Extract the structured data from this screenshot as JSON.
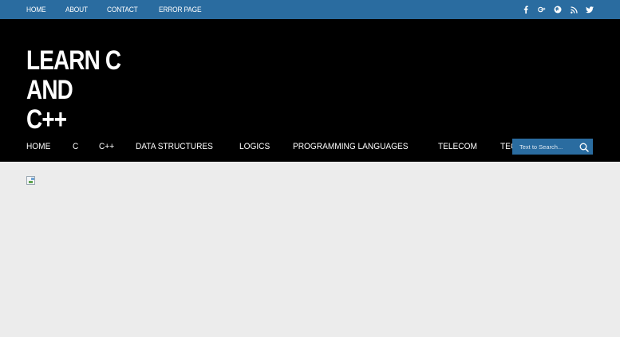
{
  "top_nav": [
    {
      "label": "HOME"
    },
    {
      "label": "ABOUT"
    },
    {
      "label": "CONTACT"
    },
    {
      "label": "ERROR PAGE"
    }
  ],
  "social_icons": [
    "facebook-icon",
    "google-plus-icon",
    "pinterest-icon",
    "rss-icon",
    "twitter-icon"
  ],
  "site": {
    "title_line1": "LEARN C AND",
    "title_line2": "C++"
  },
  "main_nav": [
    {
      "label": "HOME"
    },
    {
      "label": "C"
    },
    {
      "label": "C++"
    },
    {
      "label": "DATA STRUCTURES"
    },
    {
      "label": "LOGICS"
    },
    {
      "label": "PROGRAMMING LANGUAGES"
    },
    {
      "label": "TELECOM"
    },
    {
      "label": "TECHNOLOGY"
    }
  ],
  "search": {
    "placeholder": "Text to Search..."
  },
  "colors": {
    "accent": "#2a6ca0",
    "header_bg": "#000000",
    "content_bg": "#ececec"
  }
}
